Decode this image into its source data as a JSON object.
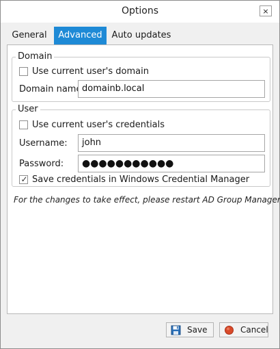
{
  "window": {
    "title": "Options",
    "close_glyph": "×"
  },
  "tabs": [
    {
      "label": "General",
      "active": false
    },
    {
      "label": "Advanced",
      "active": true
    },
    {
      "label": "Auto updates",
      "active": false
    }
  ],
  "domain_group": {
    "legend": "Domain",
    "use_current_domain": {
      "label": "Use current user's domain",
      "checked": false
    },
    "domain_name": {
      "label": "Domain name:",
      "value": "domainb.local"
    }
  },
  "user_group": {
    "legend": "User",
    "use_current_credentials": {
      "label": "Use current user's credentials",
      "checked": false
    },
    "username": {
      "label": "Username:",
      "value": "john"
    },
    "password": {
      "label": "Password:",
      "value": "●●●●●●●●●●●"
    },
    "save_credentials": {
      "label": "Save credentials in Windows Credential Manager",
      "checked": true,
      "mark": "✓"
    }
  },
  "note": "For the changes to take effect, please restart AD Group Manager",
  "buttons": {
    "save": {
      "label": "Save",
      "icon": "floppy-disk-icon"
    },
    "cancel": {
      "label": "Cancel",
      "icon": "red-circle-icon"
    }
  },
  "colors": {
    "accent": "#1e8ad6",
    "cancel_icon": "#d94a2a",
    "save_icon": "#2a6fb8"
  }
}
